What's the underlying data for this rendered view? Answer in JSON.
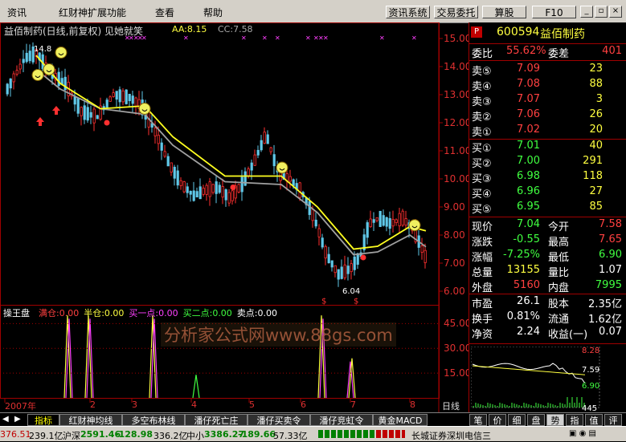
{
  "menu": {
    "items": [
      "资讯",
      "红财神扩展功能",
      "查看",
      "帮助"
    ],
    "toolbar": [
      "资讯系统",
      "交易委托",
      "算股",
      "F10"
    ]
  },
  "chart": {
    "title": "益佰制药(日线,前复权) 见她就笑",
    "aa_label": "AA:8.15",
    "cc_label": "CC:7.58",
    "y_labels": [
      "15.00",
      "14.00",
      "13.00",
      "12.00",
      "11.00",
      "10.00",
      "9.00",
      "8.00",
      "7.00",
      "6.00"
    ],
    "high_marker": "14.8",
    "low_marker": "6.04",
    "x_labels": [
      "2007年",
      "2",
      "3",
      "4",
      "5",
      "6",
      "7",
      "8"
    ],
    "period_label": "日线",
    "sub_title": "操王盘",
    "sub_items": [
      {
        "label": "满仓:0.00",
        "color": "#ff4040"
      },
      {
        "label": "半仓:0.00",
        "color": "#ffff40"
      },
      {
        "label": "买一点:0.00",
        "color": "#ff40ff"
      },
      {
        "label": "买二点:0.00",
        "color": "#40ff40"
      },
      {
        "label": "卖点:0.00",
        "color": "#ffffff"
      }
    ],
    "sub_y_labels": [
      "45.00",
      "30.00",
      "15.00"
    ],
    "watermark": "分析家公式网www.88gs.com"
  },
  "chart_data": {
    "type": "line",
    "title": "益佰制药(日线,前复权) 见她就笑",
    "xlabel": "",
    "ylabel": "",
    "ylim": [
      5.5,
      15.5
    ],
    "x": [
      "2007年",
      "2",
      "3",
      "4",
      "5",
      "6",
      "7",
      "8"
    ],
    "series": [
      {
        "name": "AA",
        "values": [
          14.5,
          13.6,
          12.5,
          12.0,
          11.5,
          10.5,
          9.0,
          7.6,
          7.2,
          8.15
        ]
      },
      {
        "name": "CC",
        "values": [
          13.8,
          13.2,
          12.8,
          11.5,
          10.8,
          10.0,
          8.8,
          7.5,
          7.3,
          7.58
        ]
      }
    ]
  },
  "quote": {
    "code": "600594",
    "name": "益佰制药",
    "wei_bi_label": "委比",
    "wei_bi": "55.62%",
    "wei_cha_label": "委差",
    "wei_cha": "401",
    "sells": [
      {
        "label": "卖⑤",
        "price": "7.09",
        "vol": "23"
      },
      {
        "label": "卖④",
        "price": "7.08",
        "vol": "88"
      },
      {
        "label": "卖③",
        "price": "7.07",
        "vol": "3"
      },
      {
        "label": "卖②",
        "price": "7.06",
        "vol": "26"
      },
      {
        "label": "卖①",
        "price": "7.02",
        "vol": "20"
      }
    ],
    "buys": [
      {
        "label": "买①",
        "price": "7.01",
        "vol": "40"
      },
      {
        "label": "买②",
        "price": "7.00",
        "vol": "291"
      },
      {
        "label": "买③",
        "price": "6.98",
        "vol": "118"
      },
      {
        "label": "买④",
        "price": "6.96",
        "vol": "27"
      },
      {
        "label": "买⑤",
        "price": "6.95",
        "vol": "85"
      }
    ],
    "stats": [
      {
        "l1": "现价",
        "v1": "7.04",
        "c1": "grn",
        "l2": "今开",
        "v2": "7.58",
        "c2": "red"
      },
      {
        "l1": "涨跌",
        "v1": "-0.55",
        "c1": "grn",
        "l2": "最高",
        "v2": "7.65",
        "c2": "red"
      },
      {
        "l1": "涨幅",
        "v1": "-7.25%",
        "c1": "grn",
        "l2": "最低",
        "v2": "6.90",
        "c2": "grn"
      },
      {
        "l1": "总量",
        "v1": "13155",
        "c1": "yel",
        "l2": "量比",
        "v2": "1.07",
        "c2": "wht"
      },
      {
        "l1": "外盘",
        "v1": "5160",
        "c1": "red",
        "l2": "内盘",
        "v2": "7995",
        "c2": "grn"
      }
    ],
    "fundamentals": [
      {
        "l1": "市盈",
        "v1": "26.1",
        "l2": "股本",
        "v2": "2.35亿"
      },
      {
        "l1": "换手",
        "v1": "0.81%",
        "l2": "流通",
        "v2": "1.62亿"
      },
      {
        "l1": "净资",
        "v1": "2.24",
        "l2": "收益(一)",
        "v2": "0.07"
      }
    ],
    "mini_chart": {
      "high": "8.28",
      "now": "7.59",
      "low": "6.90",
      "vol": "445"
    }
  },
  "tabs": [
    "指标",
    "红财神均线",
    "多空布林线",
    "潘仔死亡庄",
    "潘仔买卖令",
    "潘仔竞虹令",
    "黄金MACD"
  ],
  "right_tabs": [
    "笔",
    "价",
    "细",
    "盘",
    "势",
    "指",
    "值",
    "评"
  ],
  "status": {
    "idx1": "376.51",
    "amt1": "239.1亿",
    "sz_label": "沪深",
    "sz": "2591.46",
    "sz_chg": "-128.98",
    "sz_amt": "336.2亿",
    "zx_label": "中小",
    "zx": "3386.27",
    "zx_chg": "-189.66",
    "zx_amt": "57.33亿",
    "broker": "长城证券深圳电信三"
  }
}
